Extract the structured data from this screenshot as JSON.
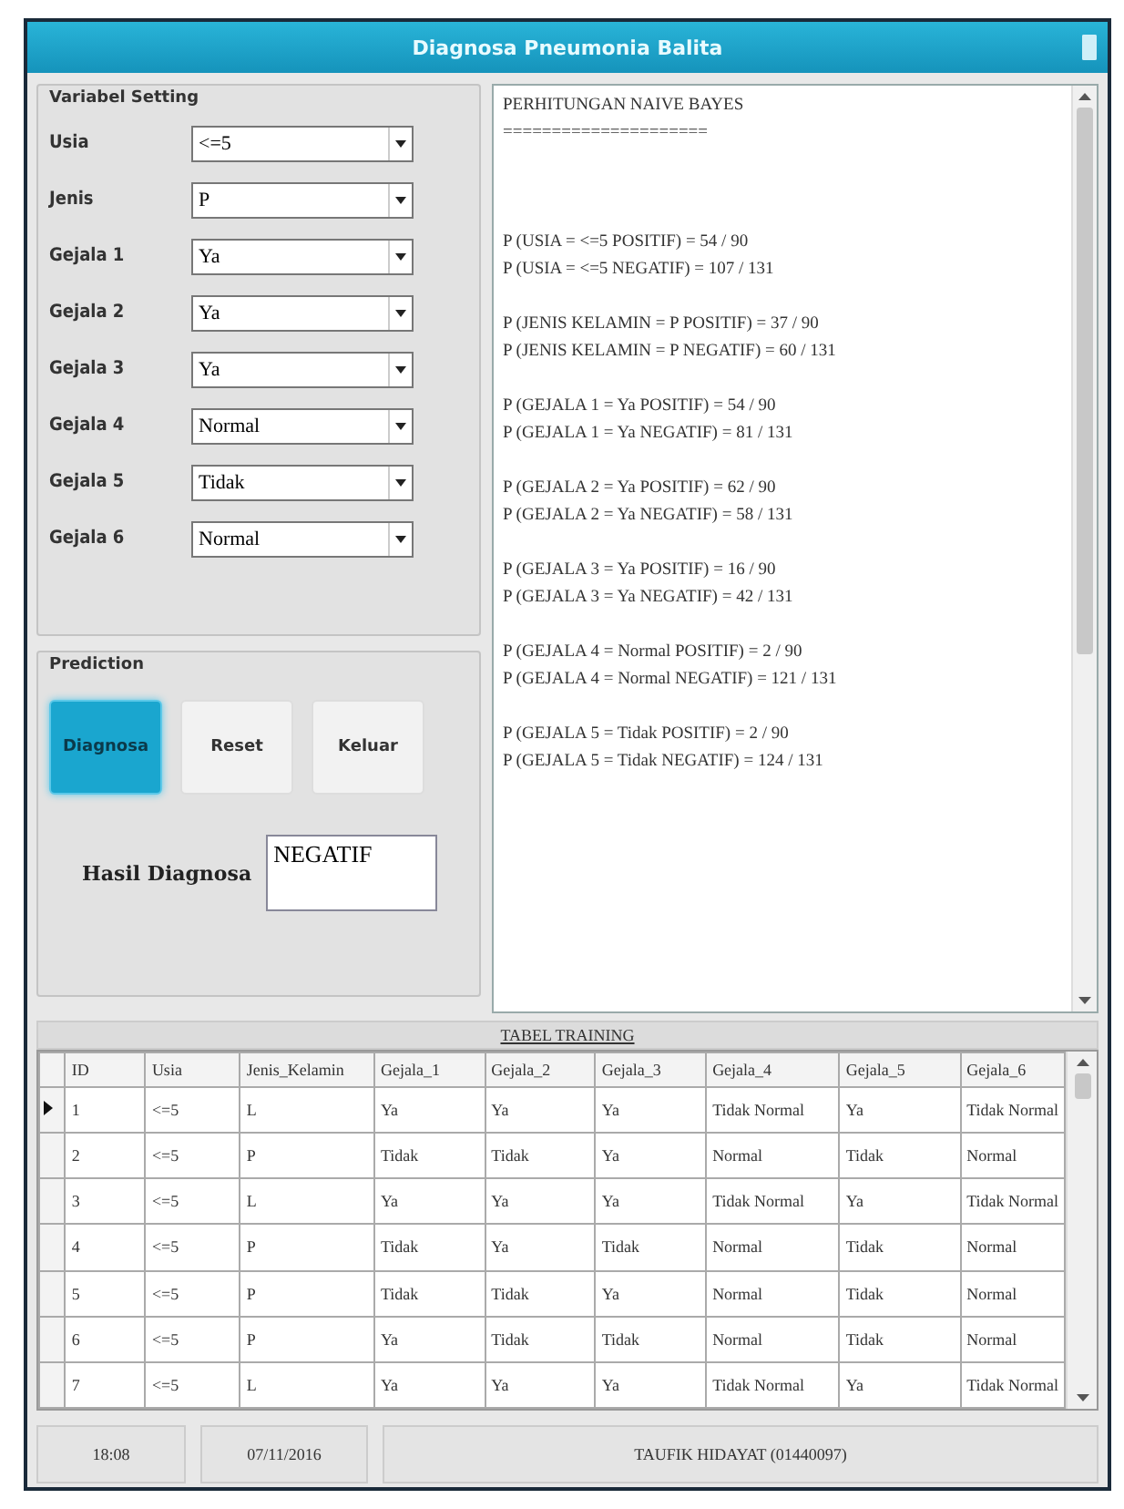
{
  "window": {
    "title": "Diagnosa Pneumonia Balita"
  },
  "variable_setting": {
    "title": "Variabel Setting",
    "fields": [
      {
        "label": "Usia",
        "value": "<=5"
      },
      {
        "label": "Jenis",
        "value": "P"
      },
      {
        "label": "Gejala 1",
        "value": "Ya"
      },
      {
        "label": "Gejala 2",
        "value": "Ya"
      },
      {
        "label": "Gejala 3",
        "value": "Ya"
      },
      {
        "label": "Gejala 4",
        "value": "Normal"
      },
      {
        "label": "Gejala 5",
        "value": "Tidak"
      },
      {
        "label": "Gejala 6",
        "value": "Normal"
      }
    ]
  },
  "prediction": {
    "title": "Prediction",
    "buttons": [
      {
        "label": "Diagnosa",
        "selected": true
      },
      {
        "label": "Reset",
        "selected": false
      },
      {
        "label": "Keluar",
        "selected": false
      }
    ],
    "result_label": "Hasil Diagnosa",
    "result_value": "NEGATIF"
  },
  "calculation_blocks": [
    [
      "PERHITUNGAN NAIVE BAYES",
      "====================="
    ],
    [
      "P (USIA = <=5 POSITIF) = 54 / 90",
      "P (USIA = <=5 NEGATIF) = 107 / 131"
    ],
    [
      "P (JENIS KELAMIN = P POSITIF) = 37 / 90",
      "P (JENIS KELAMIN = P NEGATIF) = 60 / 131"
    ],
    [
      "P (GEJALA 1 = Ya POSITIF) = 54 / 90",
      "P (GEJALA 1 = Ya NEGATIF) = 81 / 131"
    ],
    [
      "P (GEJALA 2 = Ya POSITIF) = 62 / 90",
      "P (GEJALA 2 = Ya NEGATIF) = 58 / 131"
    ],
    [
      "P (GEJALA 3 = Ya POSITIF) = 16 / 90",
      "P (GEJALA 3 = Ya NEGATIF) = 42 / 131"
    ],
    [
      "P (GEJALA 4 = Normal POSITIF) = 2 / 90",
      "P (GEJALA 4 = Normal NEGATIF) = 121 / 131"
    ],
    [
      "P (GEJALA 5 = Tidak POSITIF) = 2 / 90",
      "P (GEJALA 5 = Tidak NEGATIF) = 124 / 131"
    ]
  ],
  "table": {
    "title": "TABEL TRAINING",
    "columns": [
      "ID",
      "Usia",
      "Jenis_Kelamin",
      "Gejala_1",
      "Gejala_2",
      "Gejala_3",
      "Gejala_4",
      "Gejala_5",
      "Gejala_6"
    ],
    "rows": [
      {
        "selected": true,
        "cells": [
          "1",
          "<=5",
          "L",
          "Ya",
          "Ya",
          "Ya",
          "Tidak Normal",
          "Ya",
          "Tidak Normal"
        ]
      },
      {
        "selected": false,
        "cells": [
          "2",
          "<=5",
          "P",
          "Tidak",
          "Tidak",
          "Ya",
          "Normal",
          "Tidak",
          "Normal"
        ]
      },
      {
        "selected": false,
        "cells": [
          "3",
          "<=5",
          "L",
          "Ya",
          "Ya",
          "Ya",
          "Tidak Normal",
          "Ya",
          "Tidak Normal"
        ]
      },
      {
        "selected": false,
        "cells": [
          "4",
          "<=5",
          "P",
          "Tidak",
          "Ya",
          "Tidak",
          "Normal",
          "Tidak",
          "Normal"
        ]
      },
      {
        "selected": false,
        "cells": [
          "5",
          "<=5",
          "P",
          "Tidak",
          "Tidak",
          "Ya",
          "Normal",
          "Tidak",
          "Normal"
        ]
      },
      {
        "selected": false,
        "cells": [
          "6",
          "<=5",
          "P",
          "Ya",
          "Tidak",
          "Tidak",
          "Normal",
          "Tidak",
          "Normal"
        ]
      },
      {
        "selected": false,
        "cells": [
          "7",
          "<=5",
          "L",
          "Ya",
          "Ya",
          "Ya",
          "Tidak Normal",
          "Ya",
          "Tidak Normal"
        ]
      }
    ]
  },
  "status_bar": [
    "18:08",
    "07/11/2016",
    "TAUFIK HIDAYAT (01440097)"
  ]
}
